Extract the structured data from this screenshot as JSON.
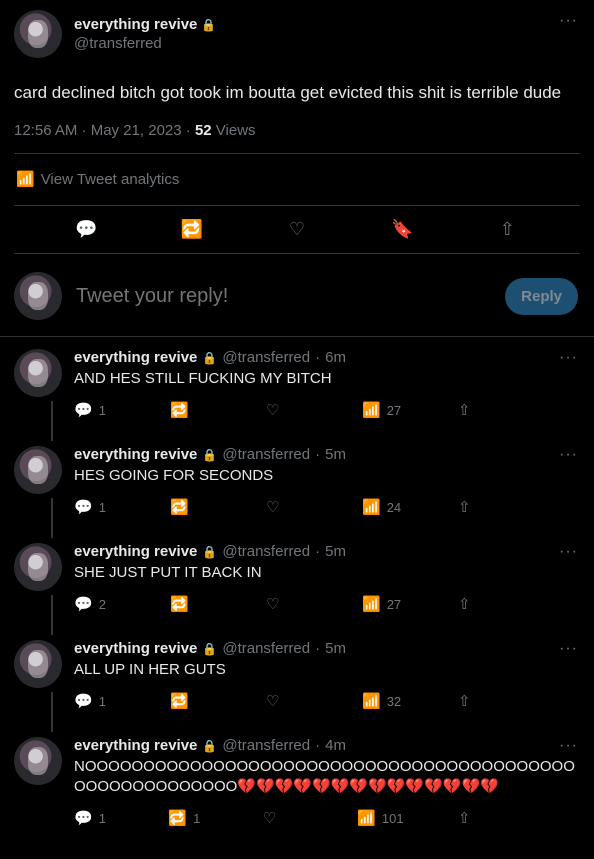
{
  "author": {
    "name": "everything revive",
    "handle": "@transferred"
  },
  "main": {
    "text": "card declined bitch got took im boutta get evicted this shit is terrible dude",
    "time": "12:56 AM · May 21, 2023 ·",
    "views_count": "52",
    "views_label": "Views",
    "analytics": "View Tweet analytics"
  },
  "reply_box": {
    "placeholder": "Tweet your reply!",
    "button": "Reply"
  },
  "replies": [
    {
      "age": "6m",
      "text": "AND HES STILL FUCKING MY BITCH",
      "replies": "1",
      "retweets": "",
      "views": "27"
    },
    {
      "age": "5m",
      "text": "HES GOING FOR SECONDS",
      "replies": "1",
      "retweets": "",
      "views": "24"
    },
    {
      "age": "5m",
      "text": "SHE JUST PUT IT BACK IN",
      "replies": "2",
      "retweets": "",
      "views": "27"
    },
    {
      "age": "5m",
      "text": "ALL UP IN HER GUTS",
      "replies": "1",
      "retweets": "",
      "views": "32"
    },
    {
      "age": "4m",
      "text": "NOOOOOOOOOOOOOOOOOOOOOOOOOOOOOOOOOOOOOOOOOOOOOOOOOOOOOOOO💔💔💔💔💔💔💔💔💔💔💔💔💔💔",
      "replies": "1",
      "retweets": "1",
      "views": "101"
    }
  ]
}
